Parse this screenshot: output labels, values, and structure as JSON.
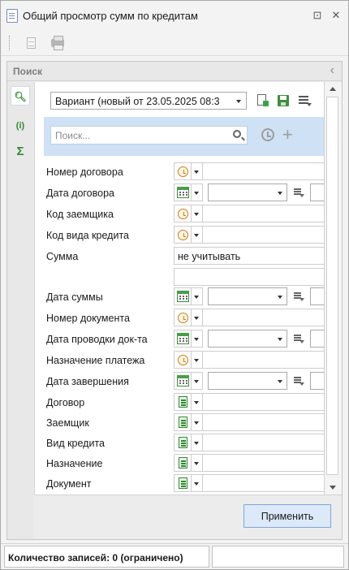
{
  "window": {
    "title": "Общий просмотр сумм по кредитам",
    "pin_glyph": "⊡",
    "close_glyph": "✕"
  },
  "panel": {
    "title": "Поиск",
    "collapse_glyph": "‹"
  },
  "side_tabs": [
    {
      "name": "search-tab",
      "glyph": "🔍︎"
    },
    {
      "name": "info-tab",
      "glyph": "(i)"
    },
    {
      "name": "sum-tab",
      "glyph": "Σ"
    }
  ],
  "variant": {
    "selected": "Вариант (новый от 23.05.2025 08:3"
  },
  "search": {
    "placeholder": "Поиск...",
    "value": ""
  },
  "plus_glyph": "+",
  "fields": [
    {
      "label": "Номер договора",
      "kind": "lookup"
    },
    {
      "label": "Дата договора",
      "kind": "date"
    },
    {
      "label": "Код заемщика",
      "kind": "lookup"
    },
    {
      "label": "Код вида кредита",
      "kind": "lookup"
    },
    {
      "label": "Сумма",
      "kind": "sum",
      "value": "не учитывать"
    },
    {
      "label": "Дата суммы",
      "kind": "date"
    },
    {
      "label": "Номер документа",
      "kind": "lookup"
    },
    {
      "label": "Дата проводки док-та",
      "kind": "date"
    },
    {
      "label": "Назначение платежа",
      "kind": "lookup"
    },
    {
      "label": "Дата завершения",
      "kind": "date"
    },
    {
      "label": "Договор",
      "kind": "ref"
    },
    {
      "label": "Заемщик",
      "kind": "ref"
    },
    {
      "label": "Вид кредита",
      "kind": "ref"
    },
    {
      "label": "Назначение",
      "kind": "ref"
    },
    {
      "label": "Документ",
      "kind": "ref"
    }
  ],
  "apply_button": "Применить",
  "status": {
    "records": "Количество записей: 0 (ограничено)",
    "extra": ""
  },
  "colors": {
    "search_band": "#cfe1f4",
    "apply_button_bg": "#dce9f8",
    "apply_button_border": "#7ea6d6",
    "lookup_icon": "#d07a12",
    "calendar_icon": "#46a046",
    "ref_icon": "#2f8a2f"
  }
}
